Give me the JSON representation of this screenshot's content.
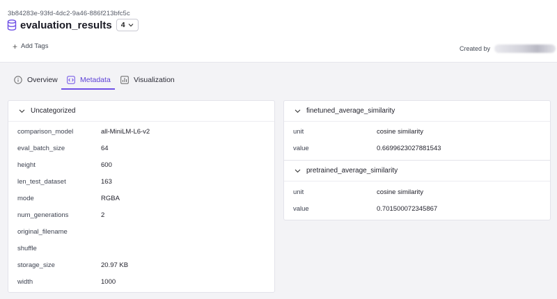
{
  "header": {
    "uuid": "3b84283e-93fd-4dc2-9a46-886f213bfc5c",
    "title": "evaluation_results",
    "version": "4",
    "add_tags_label": "Add Tags",
    "created_by_label": "Created by"
  },
  "tabs": [
    {
      "label": "Overview",
      "icon": "info-icon",
      "active": false
    },
    {
      "label": "Metadata",
      "icon": "code-icon",
      "active": true
    },
    {
      "label": "Visualization",
      "icon": "bar-chart-icon",
      "active": false
    }
  ],
  "uncategorized": {
    "title": "Uncategorized",
    "rows": [
      {
        "key": "comparison_model",
        "value": "all-MiniLM-L6-v2"
      },
      {
        "key": "eval_batch_size",
        "value": "64"
      },
      {
        "key": "height",
        "value": "600"
      },
      {
        "key": "len_test_dataset",
        "value": "163"
      },
      {
        "key": "mode",
        "value": "RGBA"
      },
      {
        "key": "num_generations",
        "value": "2"
      },
      {
        "key": "original_filename",
        "value": ""
      },
      {
        "key": "shuffle",
        "value": ""
      },
      {
        "key": "storage_size",
        "value": "20.97 KB"
      },
      {
        "key": "width",
        "value": "1000"
      }
    ]
  },
  "finetuned": {
    "title": "finetuned_average_similarity",
    "rows": [
      {
        "key": "unit",
        "value": "cosine similarity"
      },
      {
        "key": "value",
        "value": "0.6699623027881543"
      }
    ]
  },
  "pretrained": {
    "title": "pretrained_average_similarity",
    "rows": [
      {
        "key": "unit",
        "value": "cosine similarity"
      },
      {
        "key": "value",
        "value": "0.701500072345867"
      }
    ]
  },
  "colors": {
    "accent": "#6e4fe6",
    "background": "#f3f3f6"
  }
}
